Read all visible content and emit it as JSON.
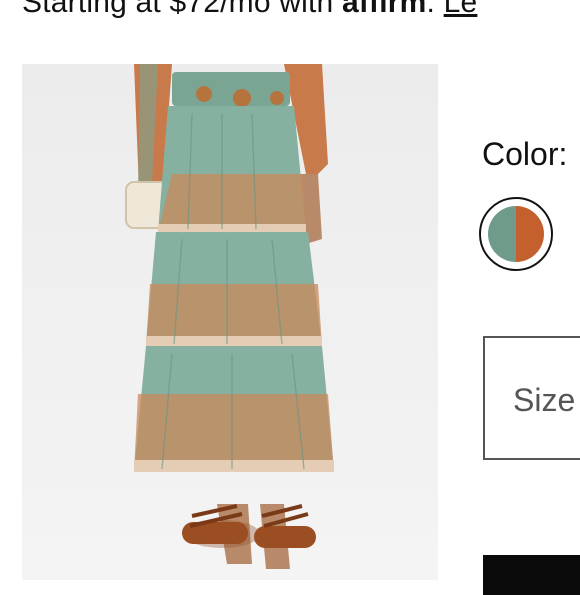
{
  "financing": {
    "prefix": "Starting at $72/mo with",
    "brand": "affirm",
    "suffix": ".",
    "link": "Le"
  },
  "product": {
    "color_label": "Color:",
    "swatch_colors": [
      "#6f9b8a",
      "#c4602d"
    ],
    "size_label": "Size"
  }
}
